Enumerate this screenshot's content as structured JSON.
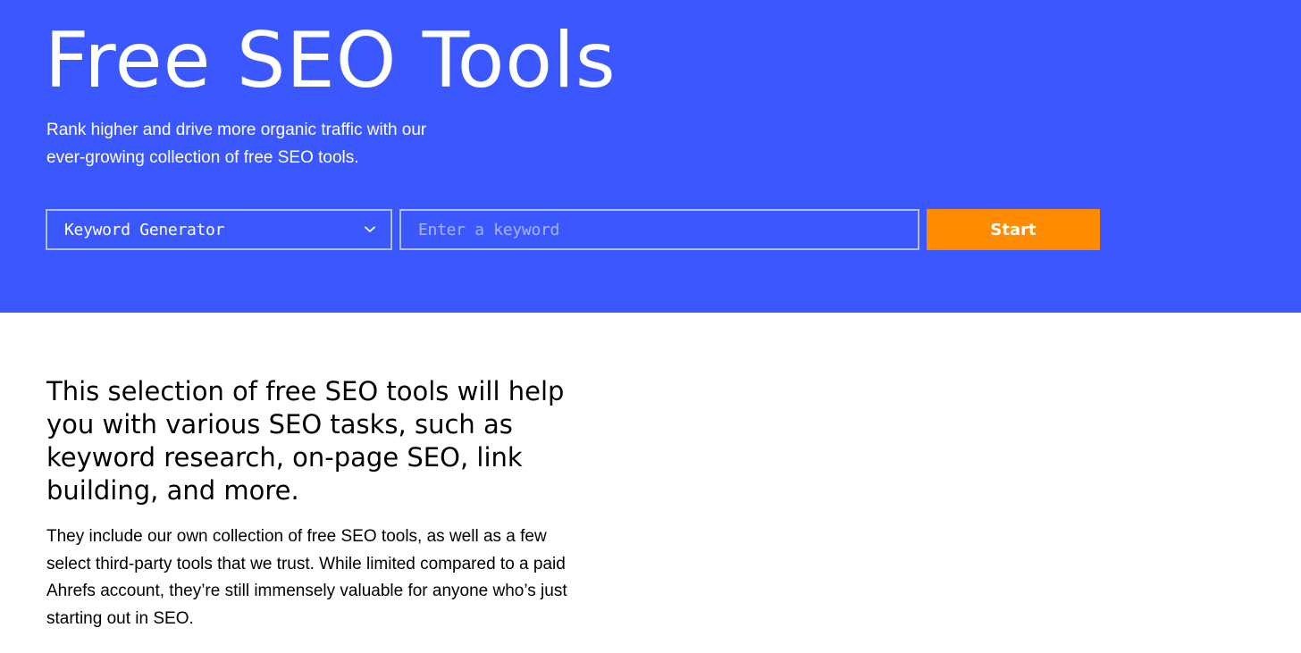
{
  "hero": {
    "title": "Free SEO Tools",
    "subtitle_lines": [
      "Rank higher and drive more organic traffic with our",
      "ever-growing collection of free SEO tools."
    ],
    "tool_select": {
      "selected": "Keyword Generator",
      "icon": "chevron-down-icon"
    },
    "keyword_input": {
      "value": "",
      "placeholder": "Enter a keyword"
    },
    "start_label": "Start"
  },
  "intro": {
    "heading_lines": [
      "This selection of free SEO tools will help",
      "you with various SEO tasks, such as",
      "keyword research, on-page SEO, link",
      "building, and more."
    ],
    "body_lines": [
      "They include our own collection of free SEO tools, as well as a few",
      "select third-party tools that we trust. While limited compared to a paid",
      "Ahrefs account, they’re still immensely valuable for anyone who’s just",
      "starting out in SEO."
    ]
  },
  "colors": {
    "hero_background": "#3b58ff",
    "start_button": "#ff8c00",
    "text_on_hero": "#ffffff",
    "body_text": "#000000"
  }
}
